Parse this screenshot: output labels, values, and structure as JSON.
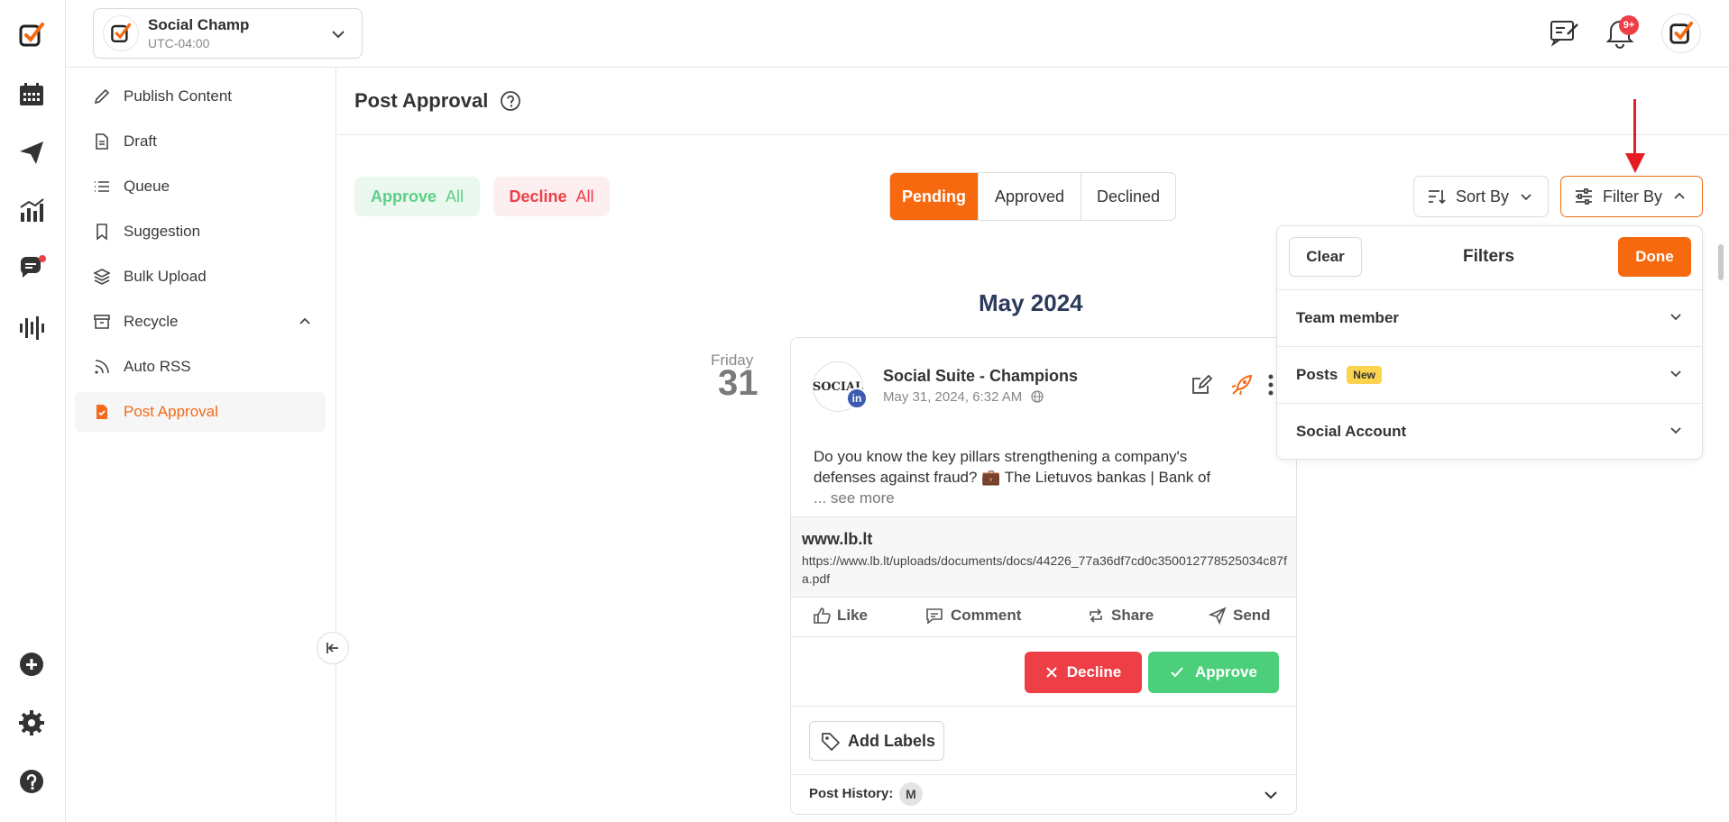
{
  "workspace": {
    "name": "Social Champ",
    "timezone": "UTC-04:00"
  },
  "header": {
    "notification_count": "9+"
  },
  "sidebar": {
    "items": [
      {
        "label": "Publish Content"
      },
      {
        "label": "Draft"
      },
      {
        "label": "Queue"
      },
      {
        "label": "Suggestion"
      },
      {
        "label": "Bulk Upload"
      },
      {
        "label": "Recycle"
      },
      {
        "label": "Auto RSS"
      },
      {
        "label": "Post Approval",
        "active": true
      }
    ]
  },
  "page": {
    "title": "Post Approval"
  },
  "bulk_actions": {
    "approve_label": "Approve",
    "approve_suffix": "All",
    "decline_label": "Decline",
    "decline_suffix": "All"
  },
  "status_tabs": [
    {
      "label": "Pending",
      "active": true
    },
    {
      "label": "Approved",
      "active": false
    },
    {
      "label": "Declined",
      "active": false
    }
  ],
  "controls": {
    "sort_label": "Sort By",
    "filter_label": "Filter By"
  },
  "filters": {
    "clear_label": "Clear",
    "title": "Filters",
    "done_label": "Done",
    "sections": [
      {
        "label": "Team member",
        "badge": ""
      },
      {
        "label": "Posts",
        "badge": "New"
      },
      {
        "label": "Social Account",
        "badge": ""
      }
    ]
  },
  "timeline": {
    "month": "May 2024",
    "day_name": "Friday",
    "day_number": "31"
  },
  "post": {
    "avatar_text": "SOCIAL",
    "network_badge": "in",
    "account_name": "Social Suite - Champions",
    "date": "May 31, 2024, 6:32 AM",
    "text_line1": "Do you know the key pillars strengthening a company's",
    "text_line2": "defenses against fraud? 💼 The Lietuvos bankas | Bank of",
    "see_more": "... see more",
    "link_domain": "www.lb.lt",
    "link_url": "https://www.lb.lt/uploads/documents/docs/44226_77a36df7cd0c350012778525034c87fa.pdf",
    "social_actions": {
      "like": "Like",
      "comment": "Comment",
      "share": "Share",
      "send": "Send"
    },
    "decline_label": "Decline",
    "approve_label": "Approve",
    "add_labels_label": "Add Labels",
    "history_label": "Post History:",
    "history_initial": "M"
  },
  "colors": {
    "accent": "#f7690f",
    "approve": "#4ccf7a",
    "decline": "#ee3e46",
    "text": "#333333"
  }
}
